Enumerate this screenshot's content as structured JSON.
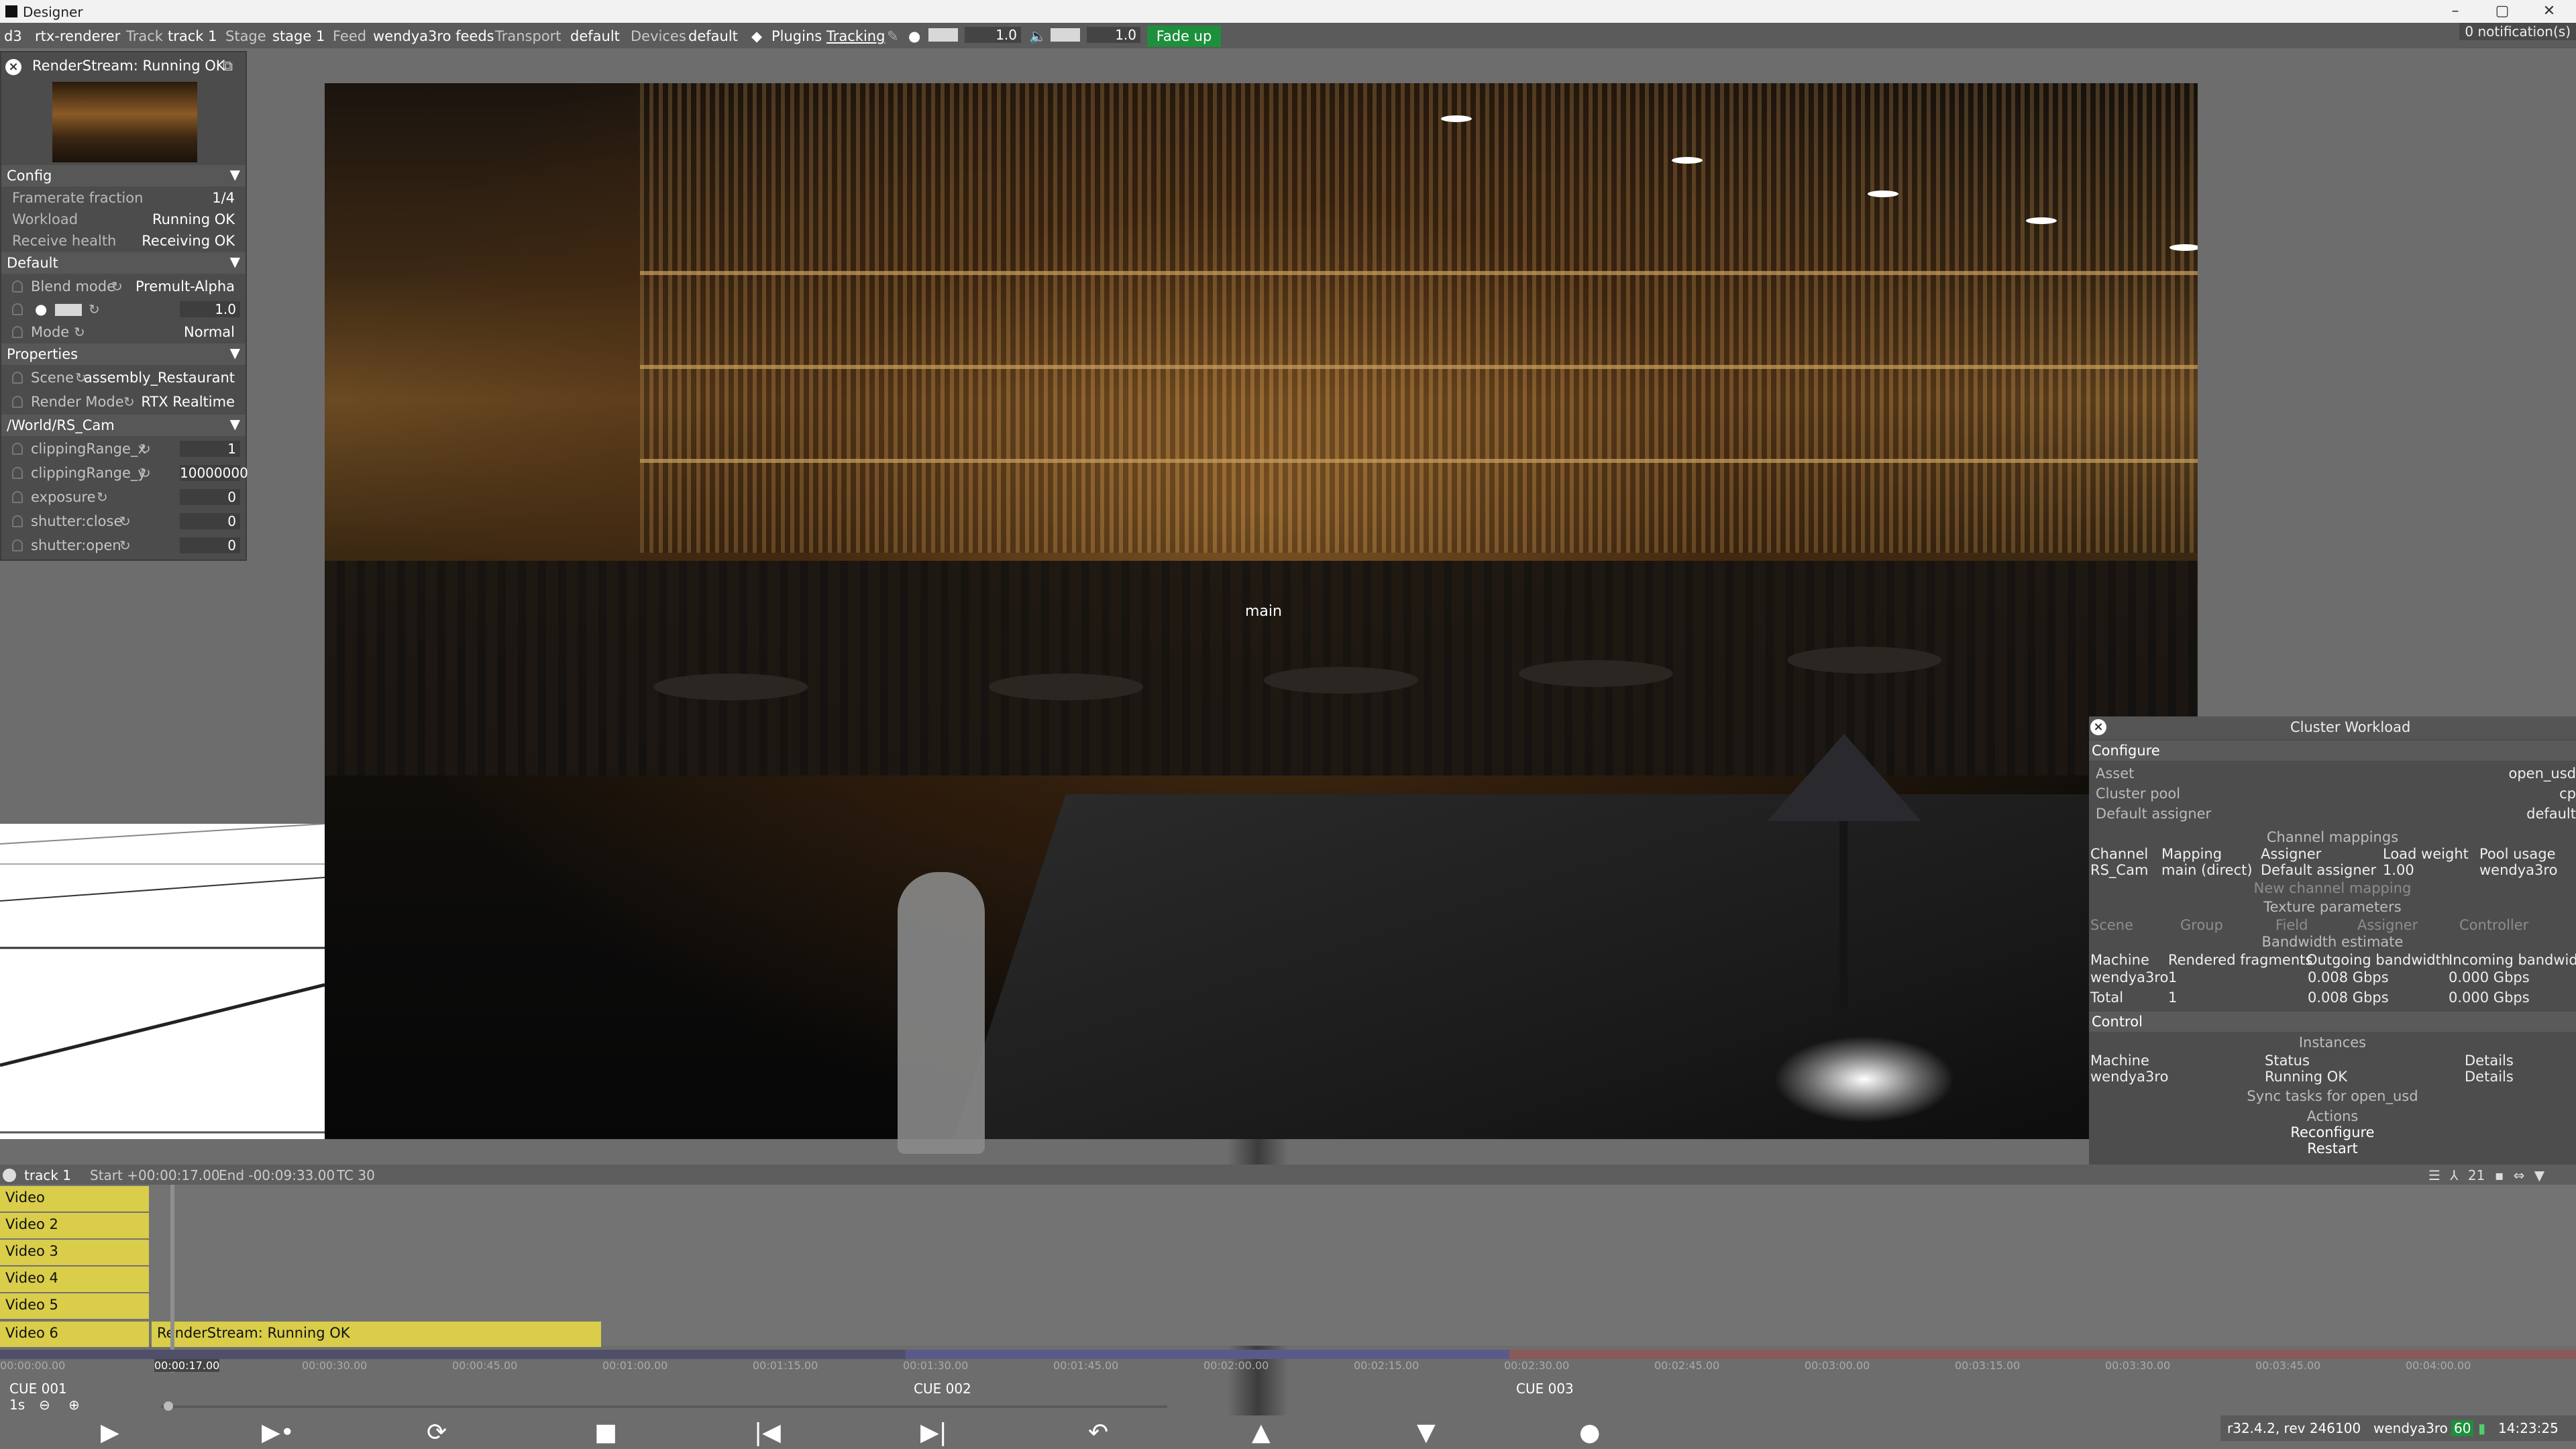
{
  "window": {
    "title": "Designer",
    "min": "–",
    "max": "▢",
    "close": "✕"
  },
  "menubar": {
    "app": "d3",
    "renderer": "rtx-renderer",
    "track_k": "Track",
    "track_v": "track 1",
    "stage_k": "Stage",
    "stage_v": "stage 1",
    "feed_k": "Feed",
    "feed_v": "wendya3ro feeds",
    "transport_k": "Transport",
    "transport_v": "default",
    "devices_k": "Devices",
    "devices_v": "default",
    "plugins": "Plugins",
    "tracking": "Tracking",
    "brightness_val": "1.0",
    "volume_val": "1.0",
    "fade": "Fade up",
    "notifications": "0 notification(s)"
  },
  "left_panel": {
    "title": "RenderStream: Running OK",
    "config": {
      "header": "Config",
      "rows": [
        {
          "label": "Framerate fraction",
          "value": "1/4"
        },
        {
          "label": "Workload",
          "value": "Running OK"
        },
        {
          "label": "Receive health",
          "value": "Receiving OK"
        }
      ]
    },
    "default": {
      "header": "Default",
      "blend_label": "Blend mode",
      "blend_value": "Premult-Alpha",
      "brightness_value": "1.0",
      "mode_label": "Mode",
      "mode_value": "Normal"
    },
    "properties": {
      "header": "Properties",
      "scene_label": "Scene",
      "scene_value": "assembly_Restaurant",
      "render_label": "Render Mode",
      "render_value": "RTX Realtime"
    },
    "camera": {
      "header": "/World/RS_Cam",
      "rows": [
        {
          "label": "clippingRange_x",
          "value": "1"
        },
        {
          "label": "clippingRange_y",
          "value": "10000000"
        },
        {
          "label": "exposure",
          "value": "0"
        },
        {
          "label": "shutter:close",
          "value": "0"
        },
        {
          "label": "shutter:open",
          "value": "0"
        }
      ]
    }
  },
  "viewport": {
    "label": "main"
  },
  "cluster": {
    "title": "Cluster Workload",
    "configure": "Configure",
    "asset_k": "Asset",
    "asset_v": "open_usd",
    "pool_k": "Cluster pool",
    "pool_v": "cp",
    "assigner_k": "Default assigner",
    "assigner_v": "default",
    "channel_mappings": "Channel mappings",
    "cm_cols": [
      "Channel",
      "Mapping",
      "Assigner",
      "Load weight",
      "Pool usage"
    ],
    "cm_row": [
      "RS_Cam",
      "main (direct)",
      "Default assigner",
      "1.00",
      "wendya3ro"
    ],
    "new_mapping": "New channel mapping",
    "texture_params": "Texture parameters",
    "tp_cols": [
      "Scene",
      "Group",
      "Field",
      "Assigner",
      "Controller"
    ],
    "bandwidth": "Bandwidth estimate",
    "bw_cols": [
      "Machine",
      "Rendered fragments",
      "Outgoing bandwidth",
      "Incoming bandwidth"
    ],
    "bw_rows": [
      [
        "wendya3ro",
        "1",
        "0.008 Gbps",
        "0.000 Gbps"
      ],
      [
        "Total",
        "1",
        "0.008 Gbps",
        "0.000 Gbps"
      ]
    ],
    "control": "Control",
    "instances": "Instances",
    "in_cols": [
      "Machine",
      "Status",
      "Details"
    ],
    "in_row": [
      "wendya3ro",
      "Running OK",
      "Details"
    ],
    "sync": "Sync tasks for open_usd",
    "actions": "Actions",
    "reconfigure": "Reconfigure",
    "restart": "Restart"
  },
  "timeline": {
    "track": "track 1",
    "start": "Start +00:00:17.00",
    "end": "End -00:09:33.00",
    "tc": "TC 30",
    "layers": [
      "Video",
      "Video 2",
      "Video 3",
      "Video 4",
      "Video 5",
      "Video 6"
    ],
    "clip": "RenderStream: Running OK",
    "ticks": [
      "00:00:00.00",
      "00:00:17.00",
      "00:00:30.00",
      "00:00:45.00",
      "00:01:00.00",
      "00:01:15.00",
      "00:01:30.00",
      "00:01:45.00",
      "00:02:00.00",
      "00:02:15.00",
      "00:02:30.00",
      "00:02:45.00",
      "00:03:00.00",
      "00:03:15.00",
      "00:03:30.00",
      "00:03:45.00",
      "00:04:00.00"
    ],
    "cues": [
      "CUE 001",
      "CUE 002",
      "CUE 003"
    ],
    "zoom": "1s",
    "icons_count": "21"
  },
  "transport": {
    "play": "▶",
    "play_to_end": "▶•",
    "loop": "⟳",
    "stop": "■",
    "prev": "|◀",
    "next": "▶|",
    "return": "↶",
    "up": "▲",
    "down": "▼",
    "record": "●"
  },
  "status": {
    "version": "r32.4.2, rev 246100",
    "machine": "wendya3ro",
    "fps": "60",
    "time": "14:23:25"
  },
  "colors": {
    "accent_green": "#1e8f3c",
    "track_yellow": "#d9cd4a"
  }
}
